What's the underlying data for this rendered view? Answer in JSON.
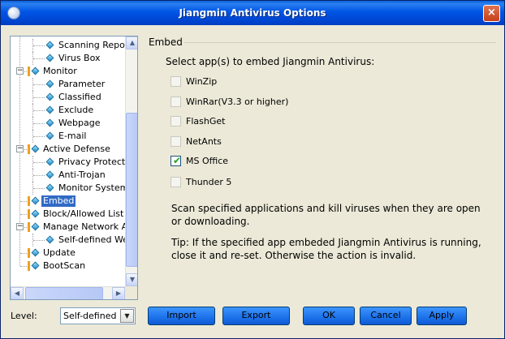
{
  "window": {
    "title": "Jiangmin Antivirus Options",
    "close_label": "×"
  },
  "tree": {
    "rows": [
      {
        "label": "Scanning Report",
        "level": 2
      },
      {
        "label": "Virus Box",
        "level": 2
      },
      {
        "label": "Monitor",
        "level": 1,
        "expander": "−"
      },
      {
        "label": "Parameter",
        "level": 2
      },
      {
        "label": "Classified",
        "level": 2
      },
      {
        "label": "Exclude",
        "level": 2
      },
      {
        "label": "Webpage",
        "level": 2
      },
      {
        "label": "E-mail",
        "level": 2
      },
      {
        "label": "Active Defense",
        "level": 1,
        "expander": "−"
      },
      {
        "label": "Privacy Protectio",
        "level": 2
      },
      {
        "label": "Anti-Trojan",
        "level": 2
      },
      {
        "label": "Monitor System",
        "level": 2
      },
      {
        "label": "Embed",
        "level": 1,
        "selected": true
      },
      {
        "label": "Block/Allowed List",
        "level": 1
      },
      {
        "label": "Manage Network Acc",
        "level": 1,
        "expander": "−"
      },
      {
        "label": "Self-defined Web",
        "level": 2
      },
      {
        "label": "Update",
        "level": 1
      },
      {
        "label": "BootScan",
        "level": 1
      }
    ],
    "scroll_up": "▲",
    "scroll_down": "▼",
    "scroll_left": "◀",
    "scroll_right": "▶"
  },
  "embed": {
    "group_title": "Embed",
    "prompt": "Select app(s) to embed Jiangmin Antivirus:",
    "apps": [
      {
        "label": "WinZip",
        "checked": false,
        "enabled": false
      },
      {
        "label": "WinRar(V3.3 or higher)",
        "checked": false,
        "enabled": false
      },
      {
        "label": "FlashGet",
        "checked": false,
        "enabled": false
      },
      {
        "label": "NetAnts",
        "checked": false,
        "enabled": false
      },
      {
        "label": "MS Office",
        "checked": true,
        "enabled": true
      },
      {
        "label": "Thunder 5",
        "checked": false,
        "enabled": false
      }
    ],
    "description": "Scan specified applications and kill viruses when they are open or downloading.",
    "tip": "Tip: If the specified app embeded Jiangmin Antivirus is running, close it and re-set. Otherwise the action is invalid."
  },
  "footer": {
    "level_label": "Level:",
    "level_value": "Self-defined",
    "buttons": {
      "import": "Import",
      "export": "Export",
      "ok": "OK",
      "cancel": "Cancel",
      "apply": "Apply"
    }
  },
  "colors": {
    "title_bar": "#0055e5",
    "selection": "#316ac5",
    "button_blue": "#1c71e8",
    "check": "#21a121"
  }
}
